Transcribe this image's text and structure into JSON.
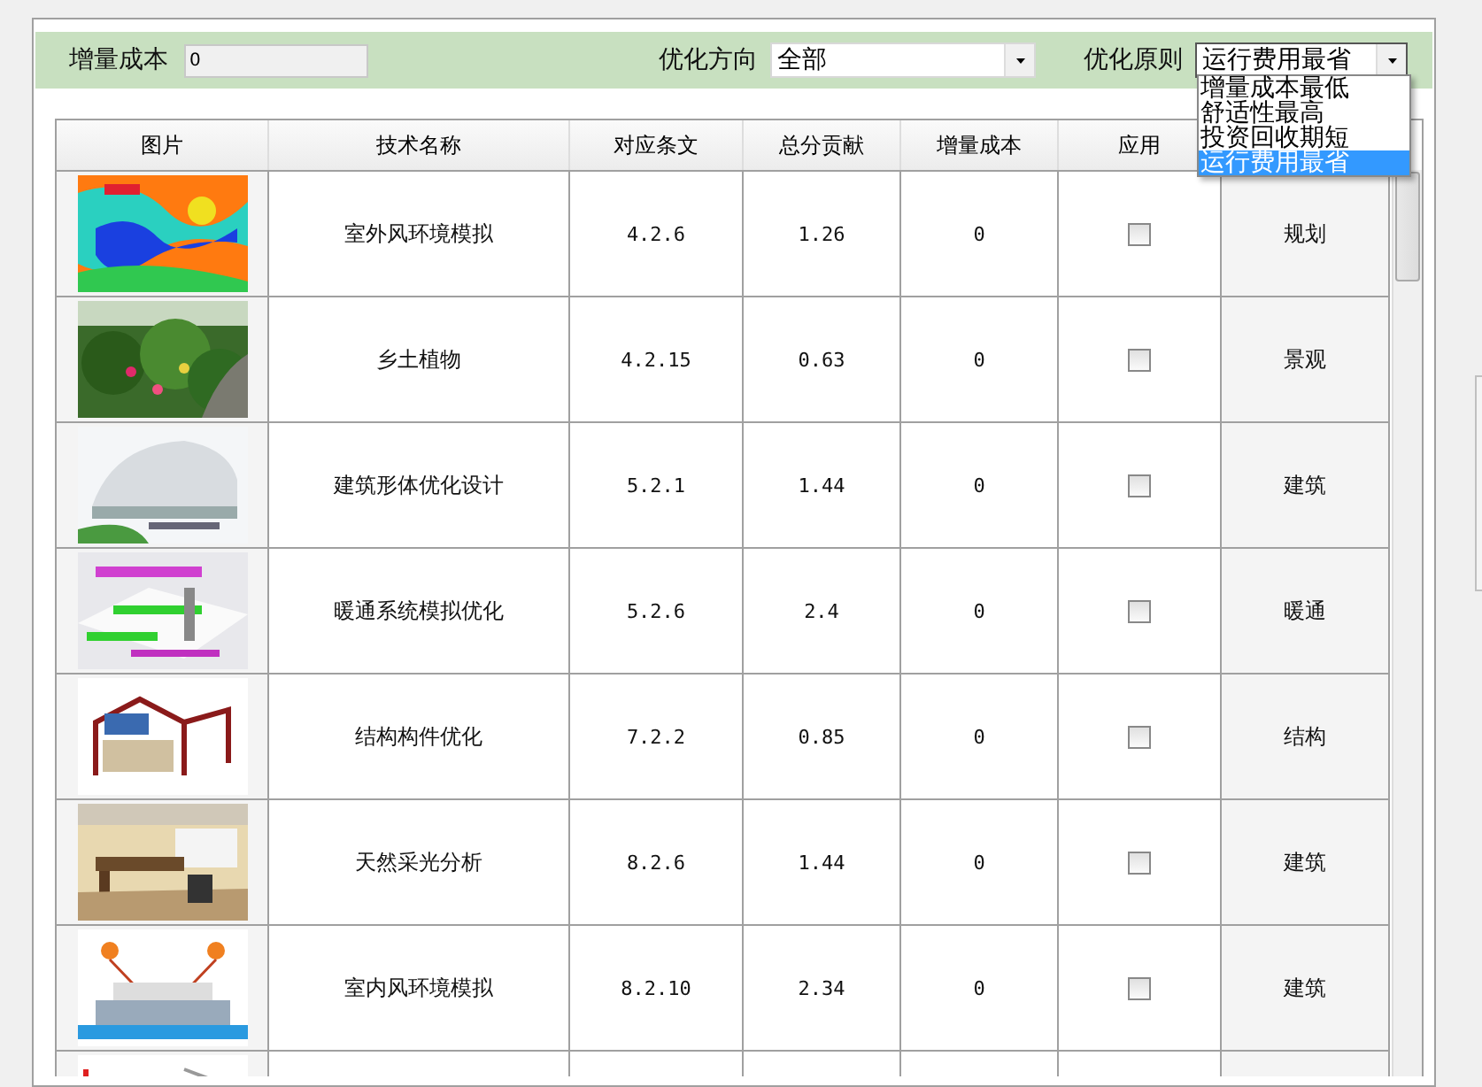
{
  "filters": {
    "cost_label": "增量成本",
    "cost_value": "0",
    "direction_label": "优化方向",
    "direction_value": "全部",
    "principle_label": "优化原则",
    "principle_value": "运行费用最省",
    "principle_options": [
      {
        "label": "增量成本最低",
        "selected": false
      },
      {
        "label": "舒适性最高",
        "selected": false
      },
      {
        "label": "投资回收期短",
        "selected": false
      },
      {
        "label": "运行费用最省",
        "selected": true
      }
    ]
  },
  "table": {
    "columns": [
      "图片",
      "技术名称",
      "对应条文",
      "总分贡献",
      "增量成本",
      "应用"
    ],
    "rows": [
      {
        "kind": "full",
        "name": "室外风环境模拟",
        "clause": "4.2.6",
        "score": "1.26",
        "cost": "0",
        "checked": false,
        "category": "规划"
      },
      {
        "kind": "full",
        "name": "乡土植物",
        "clause": "4.2.15",
        "score": "0.63",
        "cost": "0",
        "checked": false,
        "category": "景观"
      },
      {
        "kind": "full",
        "name": "建筑形体优化设计",
        "clause": "5.2.1",
        "score": "1.44",
        "cost": "0",
        "checked": false,
        "category": "建筑"
      },
      {
        "kind": "full",
        "name": "暖通系统模拟优化",
        "clause": "5.2.6",
        "score": "2.4",
        "cost": "0",
        "checked": false,
        "category": "暖通"
      },
      {
        "kind": "full",
        "name": "结构构件优化",
        "clause": "7.2.2",
        "score": "0.85",
        "cost": "0",
        "checked": false,
        "category": "结构"
      },
      {
        "kind": "full",
        "name": "天然采光分析",
        "clause": "8.2.6",
        "score": "1.44",
        "cost": "0",
        "checked": false,
        "category": "建筑"
      },
      {
        "kind": "full",
        "name": "室内风环境模拟",
        "clause": "8.2.10",
        "score": "2.34",
        "cost": "0",
        "checked": false,
        "category": "建筑"
      },
      {
        "kind": "cut"
      }
    ]
  }
}
